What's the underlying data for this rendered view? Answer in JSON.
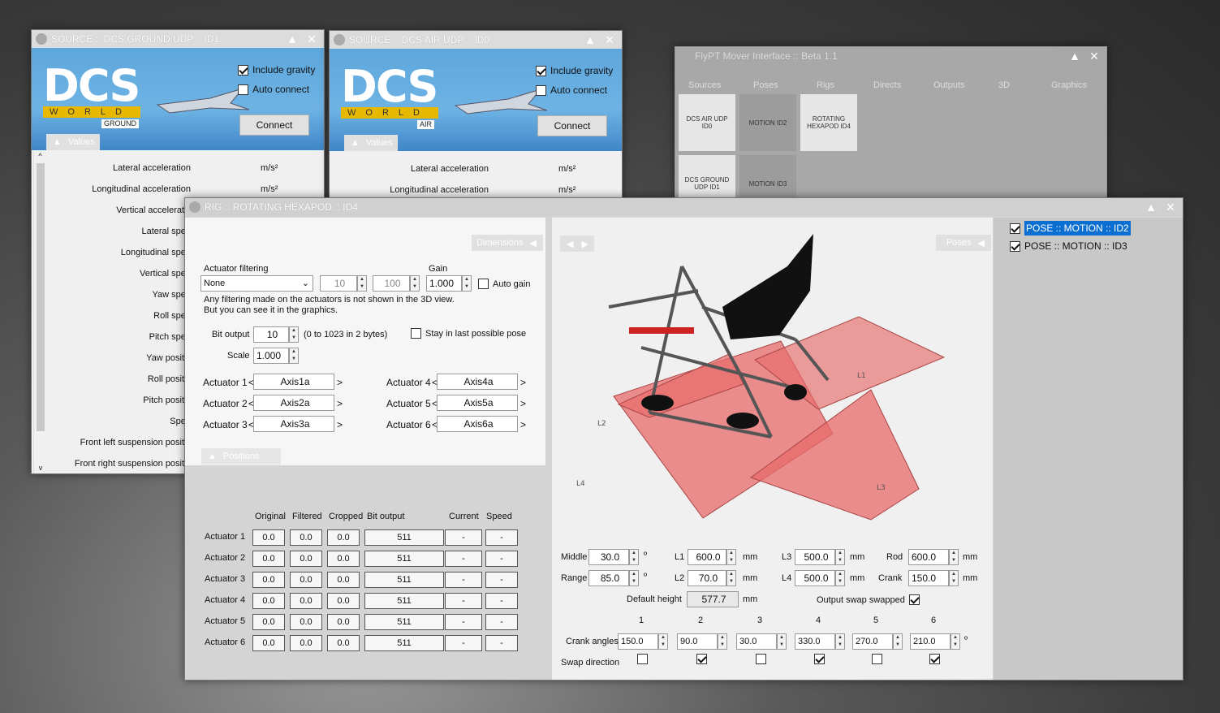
{
  "ground": {
    "title": "SOURCE :: DCS GROUND UDP :: ID1",
    "tag": "GROUND",
    "include_gravity": "Include gravity",
    "auto_connect": "Auto connect",
    "connect": "Connect",
    "values": "Values",
    "rows": [
      {
        "label": "Lateral acceleration",
        "unit": "m/s²"
      },
      {
        "label": "Longitudinal acceleration",
        "unit": "m/s²"
      },
      {
        "label": "Vertical acceleratic",
        "unit": ""
      },
      {
        "label": "Lateral spee",
        "unit": ""
      },
      {
        "label": "Longitudinal spee",
        "unit": ""
      },
      {
        "label": "Vertical spee",
        "unit": ""
      },
      {
        "label": "Yaw spee",
        "unit": ""
      },
      {
        "label": "Roll spee",
        "unit": ""
      },
      {
        "label": "Pitch spee",
        "unit": ""
      },
      {
        "label": "Yaw positic",
        "unit": ""
      },
      {
        "label": "Roll positic",
        "unit": ""
      },
      {
        "label": "Pitch positic",
        "unit": ""
      },
      {
        "label": "Spee",
        "unit": ""
      },
      {
        "label": "Front left suspension positic",
        "unit": ""
      },
      {
        "label": "Front right suspension positic",
        "unit": ""
      }
    ]
  },
  "air": {
    "title": "SOURCE :: DCS AIR UDP :: ID0",
    "tag": "AIR",
    "include_gravity": "Include gravity",
    "auto_connect": "Auto connect",
    "connect": "Connect",
    "values": "Values",
    "rows": [
      {
        "label": "Lateral acceleration",
        "unit": "m/s²"
      },
      {
        "label": "Longitudinal acceleration",
        "unit": "m/s²"
      }
    ]
  },
  "dcs_logo": "DCS",
  "dcs_world": "WORLD",
  "flypt": {
    "title": "FlyPT Mover Interface :: Beta 1.1",
    "tabs": [
      "Sources",
      "Poses",
      "Rigs",
      "Directs",
      "Outputs",
      "3D",
      "Graphics"
    ],
    "tiles": [
      "DCS AIR UDP ID0",
      "MOTION ID2",
      "ROTATING HEXAPOD ID4",
      "DCS GROUND UDP ID1",
      "MOTION ID3"
    ]
  },
  "rig": {
    "title": "RIG :: ROTATING HEXAPOD :: ID4",
    "dimensions": "Dimensions",
    "poses": "Poses",
    "positions_label": "Positions",
    "actuator_filtering": "Actuator filtering",
    "filter": "None",
    "f1": "10",
    "f2": "100",
    "gain_label": "Gain",
    "gain": "1.000",
    "auto_gain": "Auto gain",
    "note1": "Any filtering made on the actuators is not shown in the 3D view.",
    "note2": "But you can see it in the graphics.",
    "bit_output_label": "Bit output",
    "bit_output": "10",
    "bit_range": "(0 to 1023 in 2 bytes)",
    "stay": "Stay in last possible pose",
    "scale_label": "Scale",
    "scale": "1.000",
    "actuators": [
      {
        "label": "Actuator 1",
        "axis": "Axis1a"
      },
      {
        "label": "Actuator 2",
        "axis": "Axis2a"
      },
      {
        "label": "Actuator 3",
        "axis": "Axis3a"
      },
      {
        "label": "Actuator 4",
        "axis": "Axis4a"
      },
      {
        "label": "Actuator 5",
        "axis": "Axis5a"
      },
      {
        "label": "Actuator 6",
        "axis": "Axis6a"
      }
    ],
    "pos_headers": [
      "Original",
      "Filtered",
      "Cropped",
      "Bit output",
      "Current",
      "Speed"
    ],
    "pos_rows": [
      {
        "label": "Actuator 1",
        "o": "0.0",
        "f": "0.0",
        "c": "0.0",
        "b": "511",
        "cur": "-",
        "sp": "-"
      },
      {
        "label": "Actuator 2",
        "o": "0.0",
        "f": "0.0",
        "c": "0.0",
        "b": "511",
        "cur": "-",
        "sp": "-"
      },
      {
        "label": "Actuator 3",
        "o": "0.0",
        "f": "0.0",
        "c": "0.0",
        "b": "511",
        "cur": "-",
        "sp": "-"
      },
      {
        "label": "Actuator 4",
        "o": "0.0",
        "f": "0.0",
        "c": "0.0",
        "b": "511",
        "cur": "-",
        "sp": "-"
      },
      {
        "label": "Actuator 5",
        "o": "0.0",
        "f": "0.0",
        "c": "0.0",
        "b": "511",
        "cur": "-",
        "sp": "-"
      },
      {
        "label": "Actuator 6",
        "o": "0.0",
        "f": "0.0",
        "c": "0.0",
        "b": "511",
        "cur": "-",
        "sp": "-"
      }
    ],
    "middle_label": "Middle",
    "middle": "30.0",
    "range_label": "Range",
    "range": "85.0",
    "deg": "º",
    "l1_label": "L1",
    "l1": "600.0",
    "l2_label": "L2",
    "l2": "70.0",
    "l3_label": "L3",
    "l3": "500.0",
    "l4_label": "L4",
    "l4": "500.0",
    "rod_label": "Rod",
    "rod": "600.0",
    "crank_label": "Crank",
    "crank": "150.0",
    "mm": "mm",
    "default_height_label": "Default height",
    "default_height": "577.7",
    "output_swap": "Output swap swapped",
    "col_nums": [
      "1",
      "2",
      "3",
      "4",
      "5",
      "6"
    ],
    "crank_angles_label": "Crank angles",
    "crank_angles": [
      "150.0",
      "90.0",
      "30.0",
      "330.0",
      "270.0",
      "210.0"
    ],
    "swap_label": "Swap direction",
    "swap": [
      false,
      true,
      false,
      true,
      false,
      true
    ],
    "diagram_labels": [
      "L1",
      "L2",
      "L3",
      "L4"
    ],
    "pose_list": [
      "POSE :: MOTION :: ID2",
      "POSE :: MOTION :: ID3"
    ]
  }
}
